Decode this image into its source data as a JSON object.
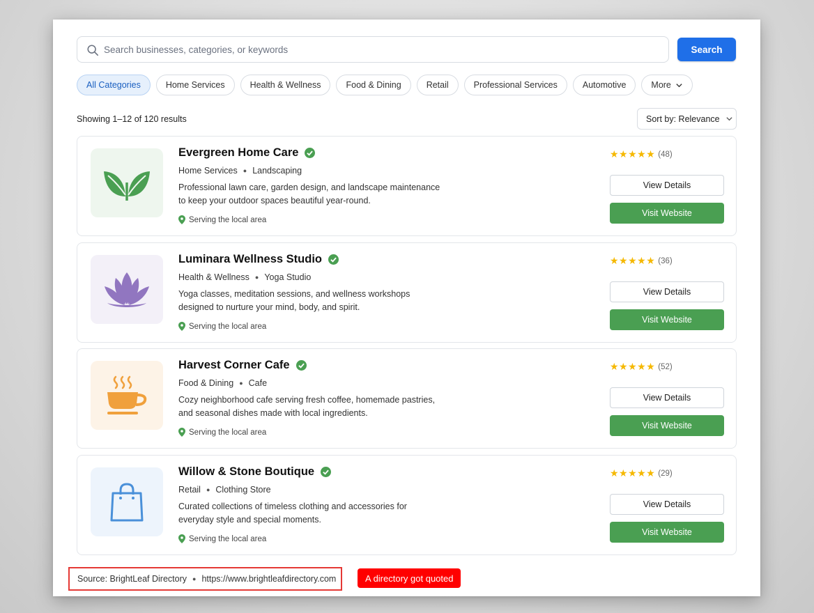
{
  "search": {
    "placeholder": "Search businesses, categories, or keywords",
    "value": "",
    "button_label": "Search",
    "accent_color": "#1f6fe8"
  },
  "categories": [
    {
      "label": "All Categories",
      "active": true
    },
    {
      "label": "Home Services",
      "active": false
    },
    {
      "label": "Health & Wellness",
      "active": false
    },
    {
      "label": "Food & Dining",
      "active": false
    },
    {
      "label": "Retail",
      "active": false
    },
    {
      "label": "Professional Services",
      "active": false
    },
    {
      "label": "Automotive",
      "active": false
    },
    {
      "label": "More",
      "active": false
    }
  ],
  "results": {
    "count_text": "Showing 1–12 of 120 results",
    "sort_label": "Sort by: Relevance"
  },
  "listings": [
    {
      "name": "Evergreen Home Care",
      "category": "Home Services",
      "subcategory": "Landscaping",
      "description": "Professional lawn care, garden design, and landscape maintenance to keep your outdoor spaces beautiful year-round.",
      "location": "Serving the local area",
      "stars": "★★★★★",
      "rating": 5,
      "reviews": "(48)",
      "icon": "leaf-icon",
      "thumb_bg": "#eef6ee",
      "icon_color": "#4a9f52",
      "details_label": "View Details",
      "visit_label": "Visit Website"
    },
    {
      "name": "Luminara Wellness Studio",
      "category": "Health & Wellness",
      "subcategory": "Yoga Studio",
      "description": "Yoga classes, meditation sessions, and wellness workshops designed to nurture your mind, body, and spirit.",
      "location": "Serving the local area",
      "stars": "★★★★★",
      "rating": 5,
      "reviews": "(36)",
      "icon": "lotus-icon",
      "thumb_bg": "#f3f0f8",
      "icon_color": "#9176c0",
      "details_label": "View Details",
      "visit_label": "Visit Website"
    },
    {
      "name": "Harvest Corner Cafe",
      "category": "Food & Dining",
      "subcategory": "Cafe",
      "description": "Cozy neighborhood cafe serving fresh coffee, homemade pastries, and seasonal dishes made with local ingredients.",
      "location": "Serving the local area",
      "stars": "★★★★★",
      "rating": 5,
      "reviews": "(52)",
      "icon": "coffee-cup-icon",
      "thumb_bg": "#fdf3e7",
      "icon_color": "#f0a03c",
      "details_label": "View Details",
      "visit_label": "Visit Website"
    },
    {
      "name": "Willow & Stone Boutique",
      "category": "Retail",
      "subcategory": "Clothing Store",
      "description": "Curated collections of timeless clothing and accessories for everyday style and special moments.",
      "location": "Serving the local area",
      "stars": "★★★★★",
      "rating": 5,
      "reviews": "(29)",
      "icon": "shopping-bag-icon",
      "thumb_bg": "#edf4fc",
      "icon_color": "#4a90d9",
      "details_label": "View Details",
      "visit_label": "Visit Website"
    }
  ],
  "colors": {
    "verified": "#4a9f52",
    "visit_button": "#4a9f52",
    "star": "#f5b800",
    "location_pin": "#4a9f52"
  },
  "source": {
    "label": "Source: BrightLeaf Directory",
    "url": "https://www.brightleafdirectory.com"
  },
  "annotation": "A directory got quoted"
}
